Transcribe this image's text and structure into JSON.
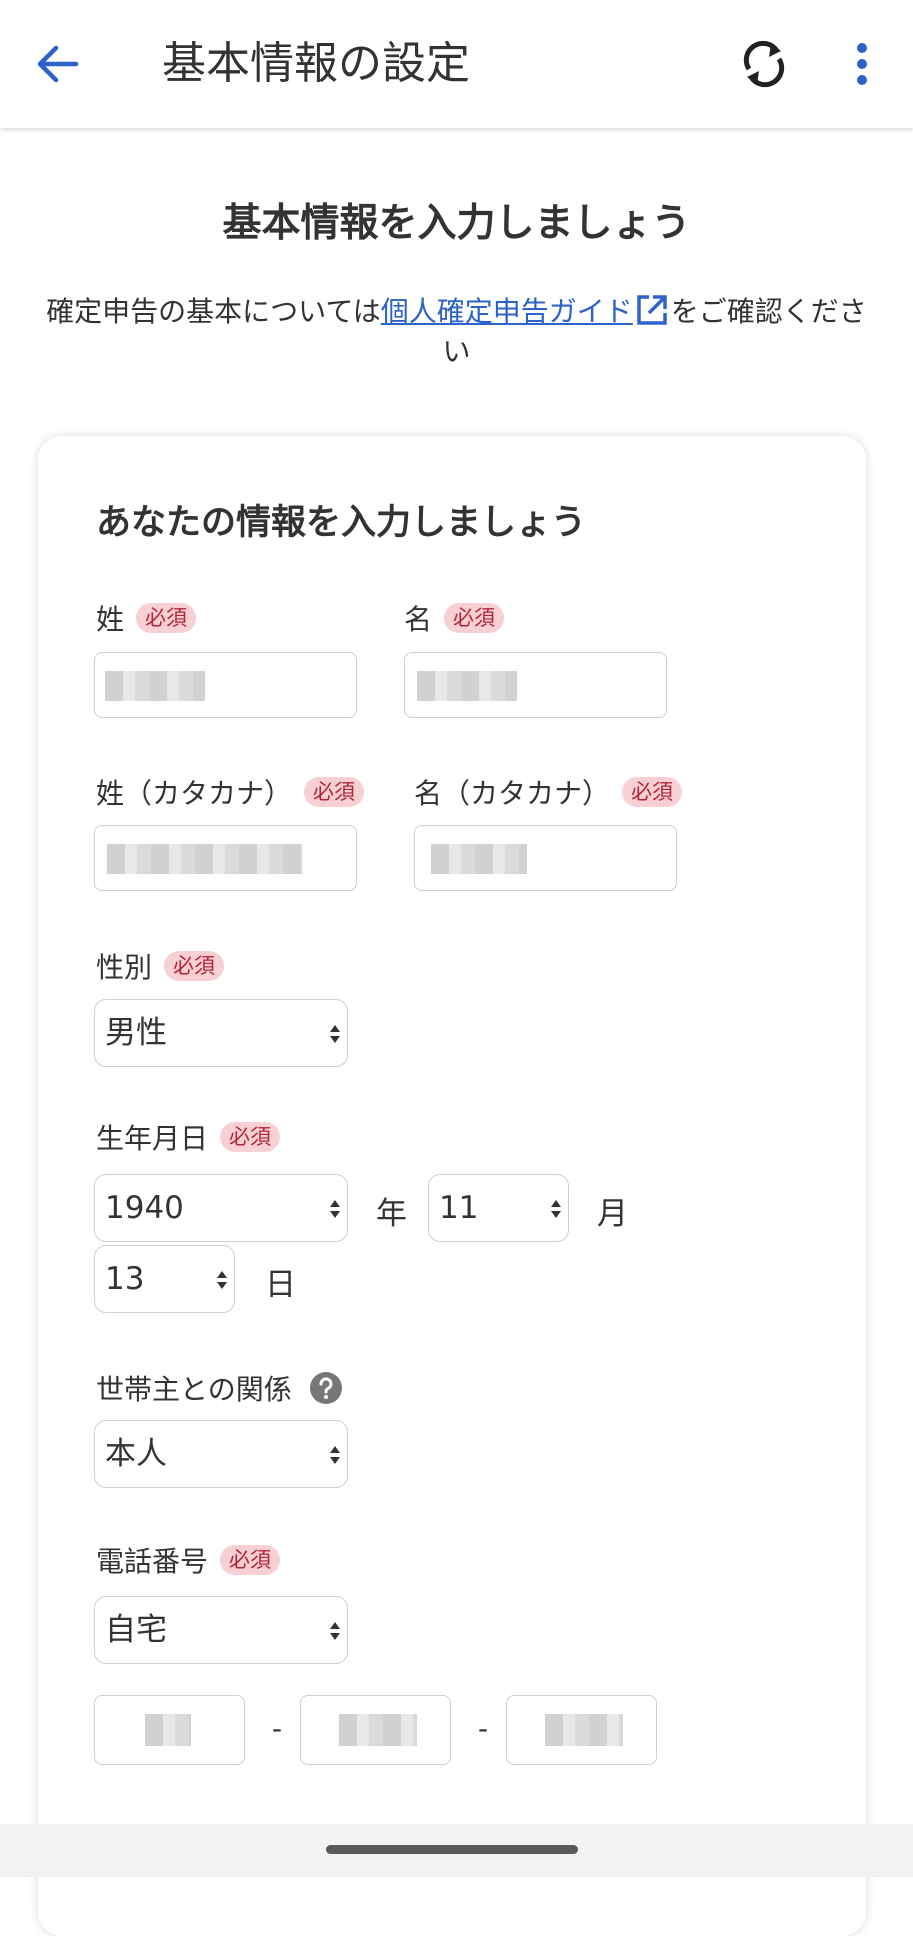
{
  "appbar": {
    "title": "基本情報の設定"
  },
  "heading": "基本情報を入力しましょう",
  "intro": {
    "before": "確定申告の基本については",
    "link": "個人確定申告ガイド",
    "after": "をご確認ください"
  },
  "card": {
    "title": "あなたの情報を入力しましょう",
    "required_badge": "必須",
    "last_name_label": "姓",
    "first_name_label": "名",
    "last_name_kana_label": "姓（カタカナ）",
    "first_name_kana_label": "名（カタカナ）",
    "gender": {
      "label": "性別",
      "value": "男性"
    },
    "birthdate": {
      "label": "生年月日",
      "year": "1940",
      "year_unit": "年",
      "month": "11",
      "month_unit": "月",
      "day": "13",
      "day_unit": "日"
    },
    "relationship": {
      "label": "世帯主との関係",
      "value": "本人"
    },
    "phone": {
      "label": "電話番号",
      "type": "自宅",
      "separator": "-"
    }
  },
  "colors": {
    "accent": "#2d63c8",
    "required_bg": "#f7d0d4",
    "required_text": "#b3243a"
  }
}
